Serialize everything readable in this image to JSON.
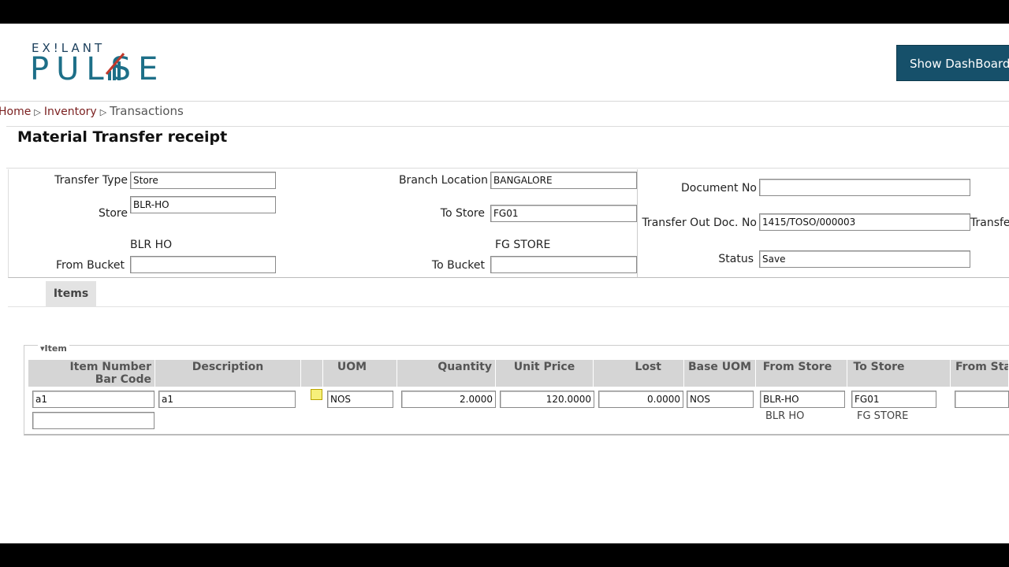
{
  "header": {
    "logo_top": "EX!LANT",
    "logo_main": "PULSE",
    "dashboard_button": "Show DashBoard"
  },
  "breadcrumb": {
    "home": "Home",
    "inventory": "Inventory",
    "current": "Transactions"
  },
  "page_title": "Material Transfer receipt",
  "form": {
    "transfer_type_label": "Transfer Type",
    "transfer_type": "Store",
    "store_label": "Store",
    "store": "BLR-HO",
    "store_name": "BLR HO",
    "from_bucket_label": "From Bucket",
    "from_bucket": "",
    "branch_location_label": "Branch Location",
    "branch_location": "BANGALORE",
    "to_store_label": "To Store",
    "to_store": "FG01",
    "to_store_name": "FG STORE",
    "to_bucket_label": "To Bucket",
    "to_bucket": "",
    "document_no_label": "Document No",
    "document_no": "",
    "transfer_out_doc_label": "Transfer Out Doc. No",
    "transfer_out_doc": "1415/TOSO/000003",
    "transfer_cut_label": "Transfe",
    "status_label": "Status",
    "status": "Save"
  },
  "tabs": {
    "items": "Items"
  },
  "item_section": {
    "legend": "▾Item",
    "columns": {
      "item_number": "Item Number",
      "bar_code": "Bar Code",
      "description": "Description",
      "uom": "UOM",
      "quantity": "Quantity",
      "unit_price": "Unit Price",
      "lost": "Lost",
      "base_uom": "Base UOM",
      "from_store": "From Store",
      "to_store": "To Store",
      "from_sta": "From Sta"
    },
    "row": {
      "item_number": "a1",
      "bar_code": "",
      "description": "a1",
      "uom": "NOS",
      "quantity": "2.0000",
      "unit_price": "120.0000",
      "lost": "0.0000",
      "base_uom": "NOS",
      "from_store": "BLR-HO",
      "from_store_name": "BLR HO",
      "to_store": "FG01",
      "to_store_name": "FG STORE",
      "from_sta": ""
    }
  },
  "colors": {
    "brand": "#1d6f88",
    "dashboard_btn": "#16506a",
    "breadcrumb_link": "#7a1f1f"
  },
  "icons": {
    "note": "note-icon"
  }
}
